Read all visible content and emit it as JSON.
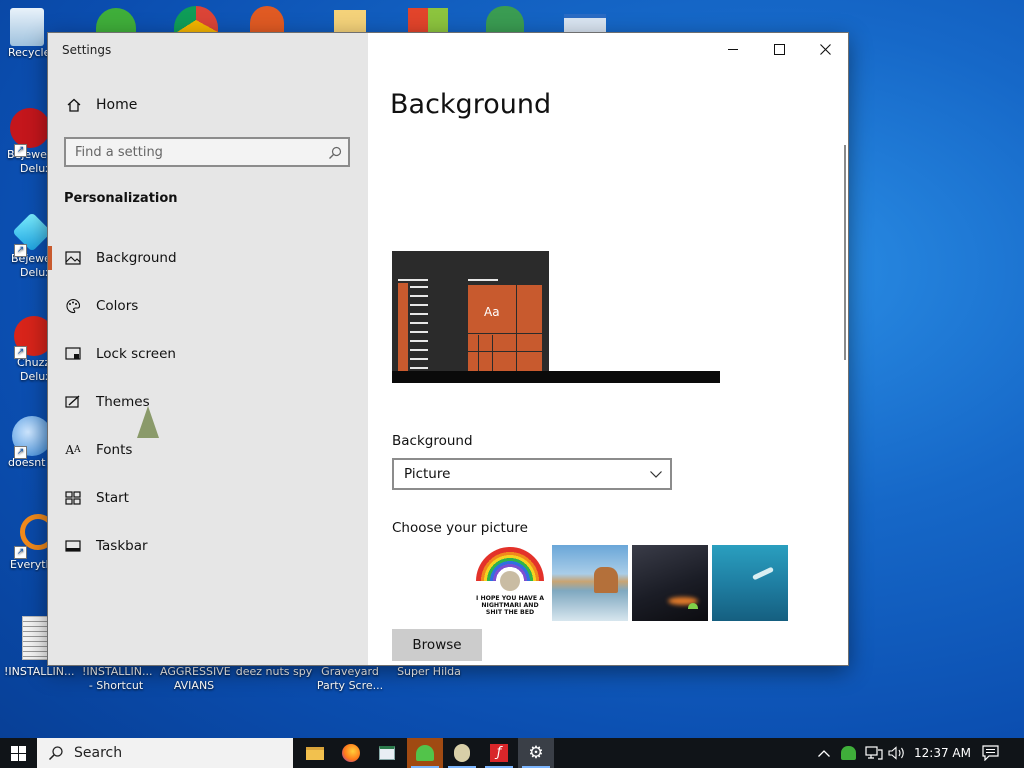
{
  "desktop": {
    "top_icons": [
      "Recycle"
    ],
    "left_icons": [
      {
        "label": "Bejewe",
        "sub": "Delux"
      },
      {
        "label": "Bejewe",
        "sub": "Delux"
      },
      {
        "label": "Chuzz",
        "sub": "Delux"
      },
      {
        "label": "doesnt",
        "sub": ""
      },
      {
        "label": "Everyth",
        "sub": ""
      }
    ],
    "bottom_icons": [
      {
        "label": "!INSTALLIN...",
        "sub": ""
      },
      {
        "label": "!INSTALLIN...",
        "sub": "- Shortcut"
      },
      {
        "label": "AGGRESSIVE",
        "sub": "AVIANS"
      },
      {
        "label": "deez nuts spy",
        "sub": ""
      },
      {
        "label": "Graveyard",
        "sub": "Party Scre..."
      },
      {
        "label": "Super Hilda",
        "sub": ""
      }
    ]
  },
  "window": {
    "title": "Settings",
    "home_label": "Home",
    "search_placeholder": "Find a setting",
    "section_title": "Personalization",
    "nav": [
      {
        "label": "Background",
        "icon": "picture-icon"
      },
      {
        "label": "Colors",
        "icon": "palette-icon"
      },
      {
        "label": "Lock screen",
        "icon": "lock-screen-icon"
      },
      {
        "label": "Themes",
        "icon": "themes-icon"
      },
      {
        "label": "Fonts",
        "icon": "fonts-icon"
      },
      {
        "label": "Start",
        "icon": "start-icon"
      },
      {
        "label": "Taskbar",
        "icon": "taskbar-icon"
      }
    ]
  },
  "content": {
    "title": "Background",
    "preview_tile_text": "Aa",
    "background_label": "Background",
    "background_value": "Picture",
    "choose_label": "Choose your picture",
    "thumb1_text": "I HOPE YOU HAVE A NIGHTMARI AND SHIT THE BED",
    "browse_label": "Browse"
  },
  "taskbar": {
    "search_label": "Search",
    "time": "12:37 AM"
  },
  "colors": {
    "accent": "#c85a2e",
    "taskbar": "#101418"
  }
}
